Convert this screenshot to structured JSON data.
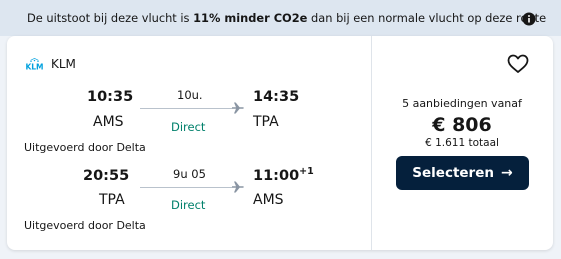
{
  "banner": {
    "text_before": "De uitstoot bij deze vlucht is ",
    "text_bold": "11% minder CO2e",
    "text_after": " dan bij een normale vlucht op deze route",
    "icon": "info-icon"
  },
  "airline": {
    "name": "KLM",
    "logo_icon": "klm-logo"
  },
  "legs": [
    {
      "depart_time": "10:35",
      "depart_code": "AMS",
      "duration": "10u.",
      "stops": "Direct",
      "arrive_time": "14:35",
      "arrive_day_offset": "",
      "arrive_code": "TPA",
      "operated_by": "Uitgevoerd door Delta"
    },
    {
      "depart_time": "20:55",
      "depart_code": "TPA",
      "duration": "9u 05",
      "stops": "Direct",
      "arrive_time": "11:00",
      "arrive_day_offset": "+1",
      "arrive_code": "AMS",
      "operated_by": "Uitgevoerd door Delta"
    }
  ],
  "pricing": {
    "offers_text": "5 aanbiedingen vanaf",
    "price": "€ 806",
    "total": "€ 1.611 totaal",
    "select_label": "Selecteren",
    "select_arrow": "→"
  },
  "colors": {
    "accent": "#05203c",
    "direct": "#00806b",
    "banner_bg": "#dde6f0"
  },
  "favorite_icon": "heart-icon"
}
